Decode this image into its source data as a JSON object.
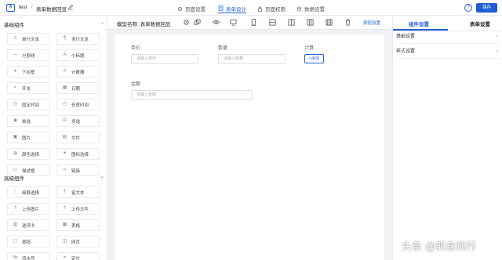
{
  "header": {
    "logo_text": "A",
    "app_name": "test",
    "separator": "/",
    "form_name": "表单数据回显",
    "tabs": [
      {
        "label": "页面设置",
        "icon": "gear-icon"
      },
      {
        "label": "表单设计",
        "icon": "form-icon",
        "active": true
      },
      {
        "label": "页面权限",
        "icon": "lock-icon"
      },
      {
        "label": "数据设置",
        "icon": "database-icon"
      }
    ],
    "help": "?",
    "save_label": "保存"
  },
  "left_panel": {
    "basic_title": "基础组件",
    "basic_items": [
      {
        "label": "单行文本",
        "icon": "text-line-icon"
      },
      {
        "label": "多行文本",
        "icon": "paragraph-icon"
      },
      {
        "label": "分割线",
        "icon": "divider-icon"
      },
      {
        "label": "小标题",
        "icon": "heading-icon"
      },
      {
        "label": "下拉框",
        "icon": "dropdown-icon"
      },
      {
        "label": "计数器",
        "icon": "counter-icon"
      },
      {
        "label": "开关",
        "icon": "switch-icon"
      },
      {
        "label": "日期",
        "icon": "calendar-icon"
      },
      {
        "label": "固定时间",
        "icon": "clock-icon"
      },
      {
        "label": "任意时间",
        "icon": "time-range-icon"
      },
      {
        "label": "单选",
        "icon": "radio-icon"
      },
      {
        "label": "多选",
        "icon": "checkbox-icon"
      },
      {
        "label": "图片",
        "icon": "image-icon"
      },
      {
        "label": "文件",
        "icon": "file-icon"
      },
      {
        "label": "颜色选择",
        "icon": "palette-icon"
      },
      {
        "label": "图标选择",
        "icon": "icon-picker-icon"
      },
      {
        "label": "描述框",
        "icon": "description-icon"
      },
      {
        "label": "链接",
        "icon": "link-icon"
      }
    ],
    "advanced_title": "高级组件",
    "advanced_items": [
      {
        "label": "级联选择",
        "icon": "cascade-icon"
      },
      {
        "label": "富文本",
        "icon": "rich-text-icon"
      },
      {
        "label": "上传图片",
        "icon": "upload-image-icon"
      },
      {
        "label": "上传文件",
        "icon": "upload-file-icon"
      },
      {
        "label": "选项卡",
        "icon": "tabs-icon"
      },
      {
        "label": "表格",
        "icon": "table-icon"
      },
      {
        "label": "按钮",
        "icon": "button-icon"
      },
      {
        "label": "网页",
        "icon": "webpage-icon"
      },
      {
        "label": "流水号",
        "icon": "serial-icon"
      },
      {
        "label": "定位",
        "icon": "location-icon"
      }
    ]
  },
  "toolbar": {
    "model_label": "模型名称: 表单数据回显",
    "link_label": "按钮设置"
  },
  "canvas": {
    "fields": [
      {
        "label": "单价",
        "placeholder": "请输入单价"
      },
      {
        "label": "数量",
        "placeholder": "请输入数量"
      },
      {
        "label": "计算",
        "button": "<添加"
      },
      {
        "label": "金额",
        "placeholder": "请输入金额"
      }
    ]
  },
  "right_panel": {
    "tabs": [
      {
        "label": "组件设置",
        "active": true
      },
      {
        "label": "表单设置"
      }
    ],
    "items": [
      "基础设置",
      "样式设置"
    ]
  },
  "watermark": "头条 @躬身践行"
}
